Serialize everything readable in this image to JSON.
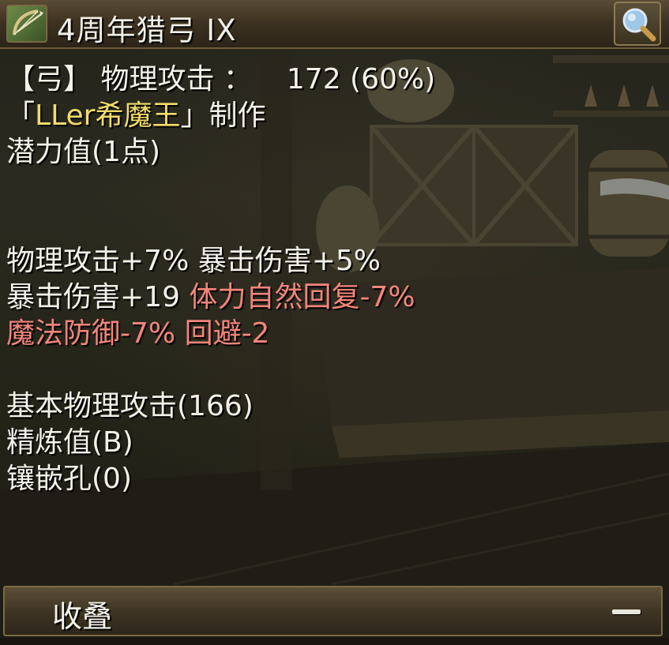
{
  "item": {
    "name": "4周年猎弓 IX",
    "icon": "bow-icon"
  },
  "header": {
    "search_icon": "magnifier-icon"
  },
  "stats": {
    "type_label": "【弓】 物理攻击 ：",
    "attack_value": "172 (60%)",
    "crafter_open": "「",
    "crafter_name": "LLer希魔王",
    "crafter_close": "」制作",
    "potential": "潜力值(1点)"
  },
  "options": {
    "line1_a": "物理攻击+7%",
    "line1_b": "暴击伤害+5%",
    "line2_a": "暴击伤害+19",
    "line2_b": "体力自然回复-7%",
    "line3_a": "魔法防御-7%",
    "line3_b": "回避-2"
  },
  "base": {
    "base_attack": "基本物理攻击(166)",
    "refine": "精炼值(B)",
    "sockets": "镶嵌孔(0)"
  },
  "footer": {
    "collapse_label": "收叠",
    "collapse_icon": "minus-icon"
  },
  "colors": {
    "normal_text": "#f4f1e8",
    "crafter_name": "#f2dc6a",
    "negative_option": "#f4857c",
    "frame": "#6d5c3c"
  }
}
